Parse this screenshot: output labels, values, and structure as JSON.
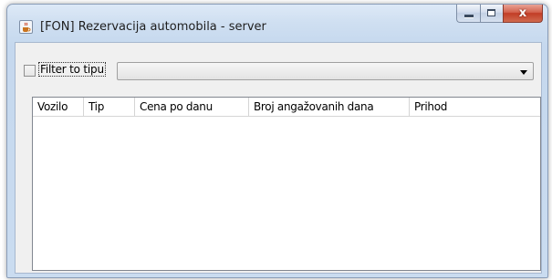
{
  "window": {
    "title": "[FON] Rezervacija automobila - server",
    "close_glyph": "x"
  },
  "filter": {
    "label": "Filter to tipu",
    "checked": false,
    "selected_value": ""
  },
  "table": {
    "columns": [
      "Vozilo",
      "Tip",
      "Cena po danu",
      "Broj angažovanih dana",
      "Prihod"
    ],
    "rows": []
  },
  "icons": {
    "app": "java-cup-icon",
    "minimize": "minimize-icon",
    "maximize": "maximize-icon",
    "close": "close-icon",
    "dropdown": "chevron-down-icon"
  },
  "colors": {
    "close_button": "#c23c26",
    "title_bar": "#cfdff1"
  }
}
